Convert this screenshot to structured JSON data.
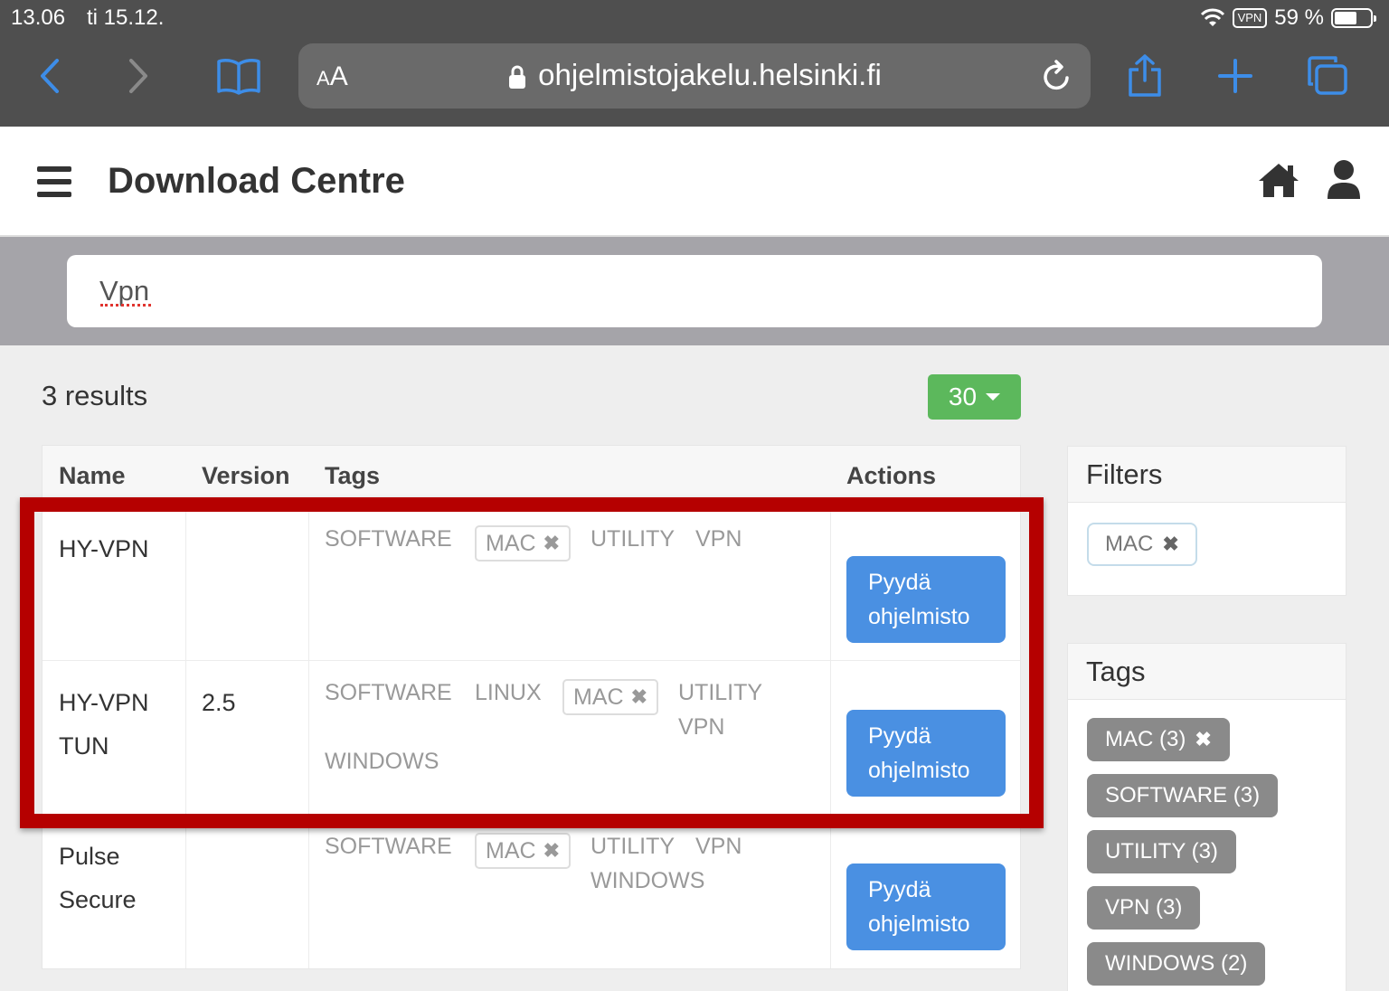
{
  "status_bar": {
    "time": "13.06",
    "date": "ti 15.12.",
    "vpn": "VPN",
    "battery": "59 %",
    "battery_level": 0.59
  },
  "browser": {
    "text_size_label": "AA",
    "url": "ohjelmistojakelu.helsinki.fi",
    "icons": [
      "back-icon",
      "forward-icon",
      "bookmarks-icon",
      "lock-icon",
      "reload-icon",
      "share-icon",
      "new-tab-icon",
      "tabs-icon"
    ]
  },
  "header": {
    "title": "Download Centre",
    "icons": [
      "menu-icon",
      "home-icon",
      "user-icon"
    ]
  },
  "search": {
    "value": "Vpn"
  },
  "results": {
    "count_text": "3 results",
    "per_page": "30",
    "columns": [
      "Name",
      "Version",
      "Tags",
      "Actions"
    ],
    "action_label_line1": "Pyydä",
    "action_label_line2": "ohjelmisto",
    "rows": [
      {
        "name_line1": "HY-VPN",
        "name_line2": "",
        "version": "",
        "tags": [
          "SOFTWARE",
          "MAC",
          "UTILITY",
          "VPN"
        ]
      },
      {
        "name_line1": "HY-VPN",
        "name_line2": "TUN",
        "version": "2.5",
        "tags": [
          "SOFTWARE",
          "LINUX",
          "MAC",
          "UTILITY",
          "VPN",
          "WINDOWS"
        ]
      },
      {
        "name_line1": "Pulse",
        "name_line2": "Secure",
        "version": "",
        "tags": [
          "SOFTWARE",
          "MAC",
          "UTILITY",
          "VPN",
          "WINDOWS"
        ]
      }
    ]
  },
  "filters": {
    "title": "Filters",
    "active": [
      "MAC"
    ]
  },
  "tags_panel": {
    "title": "Tags",
    "items": [
      "MAC (3)",
      "SOFTWARE (3)",
      "UTILITY (3)",
      "VPN (3)",
      "WINDOWS (2)"
    ]
  },
  "colors": {
    "highlight": "#b50000",
    "action_button": "#4a90e2",
    "per_page_button": "#5cb85c",
    "tag_pill": "#8a8a8a"
  }
}
